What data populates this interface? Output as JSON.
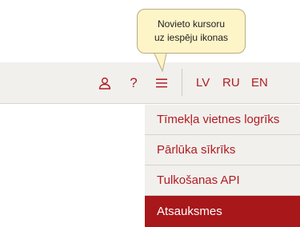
{
  "colors": {
    "accent": "#b01c22",
    "bar_background": "#f1f0ed",
    "active_item_background": "#a8171a",
    "tooltip_background": "#fdf4c8"
  },
  "toolbar": {
    "icons": {
      "user": "user-icon",
      "help": "question-mark-icon",
      "menu": "hamburger-menu-icon"
    },
    "help_glyph": "?",
    "languages": [
      "LV",
      "RU",
      "EN"
    ]
  },
  "tooltip": {
    "lines": [
      "Novieto kursoru",
      "uz iespēju ikonas"
    ]
  },
  "dropdown": {
    "items": [
      {
        "label": "Tīmekļa vietnes logrīks",
        "active": false
      },
      {
        "label": "Pārlūka sīkrīks",
        "active": false
      },
      {
        "label": "Tulkošanas API",
        "active": false
      },
      {
        "label": "Atsauksmes",
        "active": true
      }
    ]
  }
}
